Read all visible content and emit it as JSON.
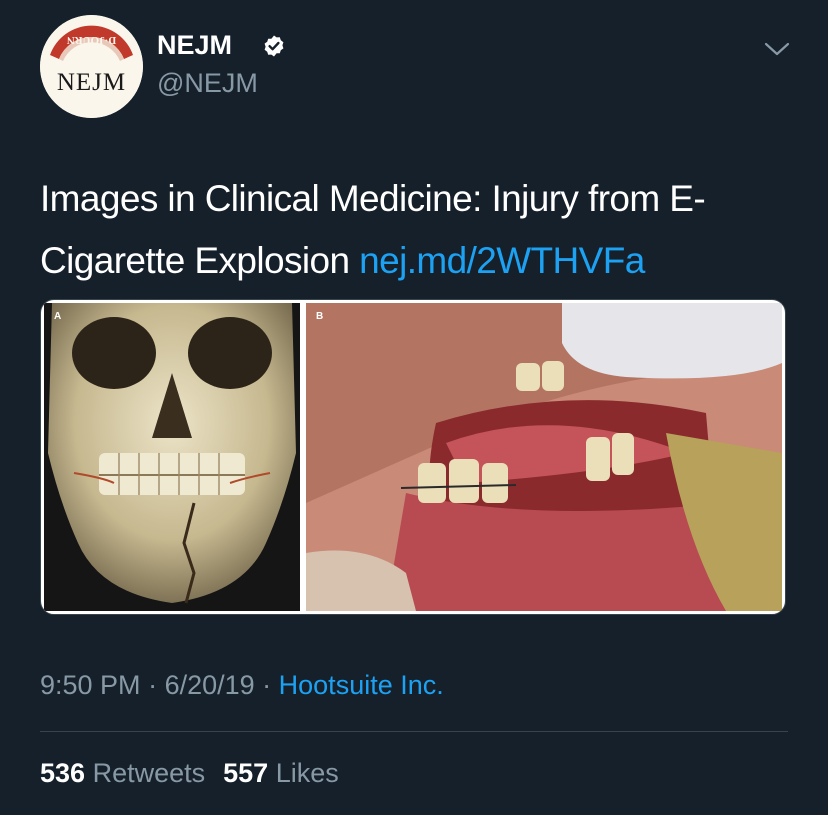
{
  "author": {
    "avatar_icon": "nejm-logo",
    "avatar_wordmark": "NEJM",
    "avatar_seal_text": "D·JOURN",
    "display_name": "NEJM",
    "verified_icon": "verified-badge-icon",
    "handle": "@NEJM"
  },
  "menu_icon": "chevron-down-icon",
  "tweet": {
    "text": "Images in Clinical Medicine: Injury from E-Cigarette Explosion ",
    "link_text": "nej.md/2WTHVFa"
  },
  "media": {
    "panel_a_label": "A",
    "panel_b_label": "B"
  },
  "meta": {
    "time": "9:50 PM",
    "separator": " · ",
    "date": "6/20/19",
    "source": "Hootsuite Inc."
  },
  "stats": {
    "retweets_count": "536",
    "retweets_label": "Retweets",
    "likes_count": "557",
    "likes_label": "Likes"
  },
  "colors": {
    "background": "#15202b",
    "text_primary": "#ffffff",
    "text_secondary": "#8899a6",
    "link": "#1da1f2",
    "divider": "#38444d"
  }
}
